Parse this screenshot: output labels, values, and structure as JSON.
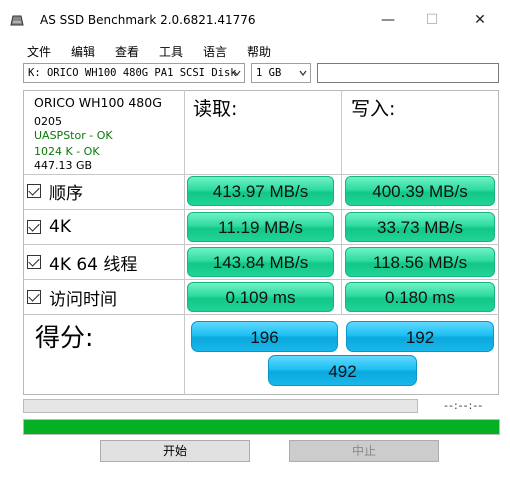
{
  "window": {
    "title": "AS SSD Benchmark 2.0.6821.41776",
    "minimize": "—",
    "maximize": "☐",
    "close": "✕"
  },
  "menu": {
    "items": [
      "文件",
      "编辑",
      "查看",
      "工具",
      "语言",
      "帮助"
    ]
  },
  "toolbar": {
    "drive": "K: ORICO WH100 480G PA1 SCSI Disk",
    "size": "1 GB",
    "text_value": ""
  },
  "device": {
    "name": "ORICO WH100 480G",
    "firmware": "0205",
    "driver_status": "UASPStor - OK",
    "alignment_status": "1024 K - OK",
    "capacity": "447.13 GB"
  },
  "columns": {
    "read": "读取:",
    "write": "写入:"
  },
  "rows": [
    {
      "label": "顺序",
      "read": "413.97 MB/s",
      "write": "400.39 MB/s",
      "checked": true
    },
    {
      "label": "4K",
      "read": "11.19 MB/s",
      "write": "33.73 MB/s",
      "checked": true
    },
    {
      "label": "4K 64 线程",
      "read": "143.84 MB/s",
      "write": "118.56 MB/s",
      "checked": true
    },
    {
      "label": "访问时间",
      "read": "0.109 ms",
      "write": "0.180 ms",
      "checked": true
    }
  ],
  "score": {
    "label": "得分:",
    "read": "196",
    "write": "192",
    "total": "492"
  },
  "progress": {
    "timer": "--:--:--",
    "test_progress": 0,
    "overall_progress": 1.0
  },
  "buttons": {
    "start": "开始",
    "stop": "中止"
  },
  "colors": {
    "result_green": "#2fdb9e",
    "score_blue": "#1ec0f2",
    "progress_green": "#06b025"
  }
}
